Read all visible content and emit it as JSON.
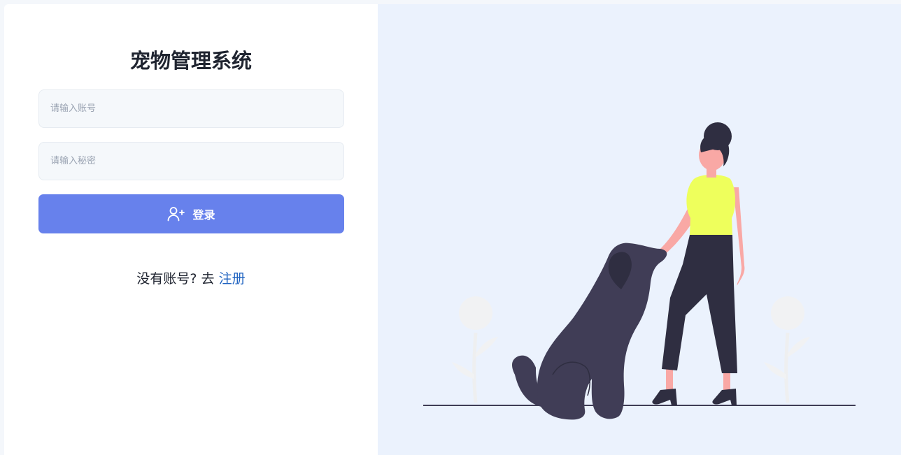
{
  "app": {
    "title": "宠物管理系统"
  },
  "login_form": {
    "account_placeholder": "请输入账号",
    "password_placeholder": "请输入秘密",
    "login_label": "登录",
    "register_prompt": "没有账号? 去",
    "register_link": "注册"
  },
  "icons": {
    "login_button_icon": "user-plus-icon"
  },
  "colors": {
    "primary_button": "#6781ec",
    "link": "#1e62c0",
    "illustration_bg": "#ebf2fd",
    "shirt": "#eeff5c",
    "dog": "#403d56",
    "pants": "#2f2e41",
    "skin": "#f9a8a5"
  }
}
